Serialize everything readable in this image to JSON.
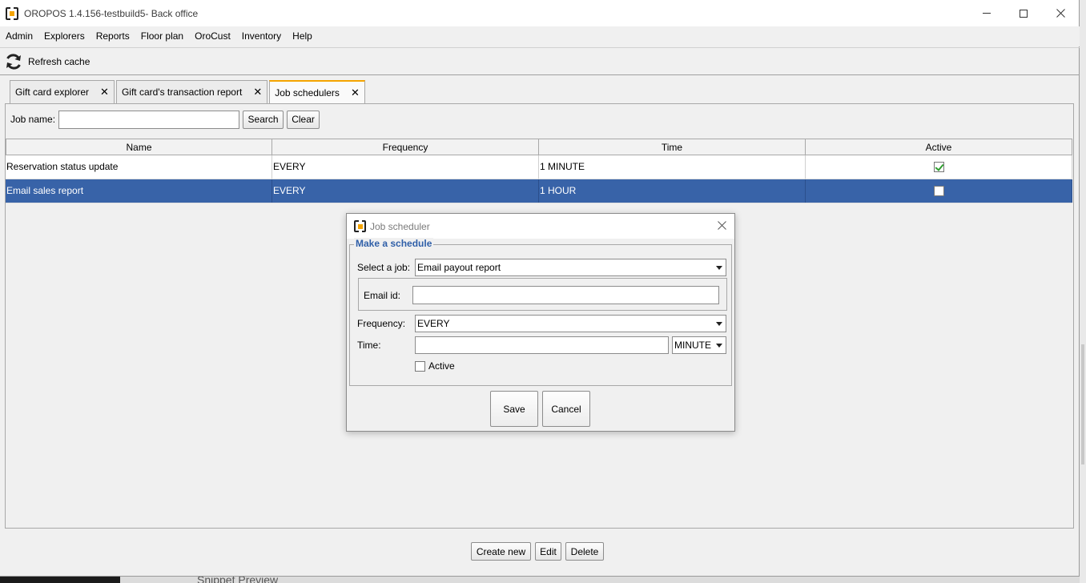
{
  "window": {
    "title": "OROPOS 1.4.156-testbuild5- Back office",
    "controls": [
      "minimize-icon",
      "maximize-icon",
      "close-icon"
    ]
  },
  "menu": {
    "items": [
      "Admin",
      "Explorers",
      "Reports",
      "Floor plan",
      "OroCust",
      "Inventory",
      "Help"
    ]
  },
  "toolbar": {
    "refresh_label": "Refresh cache",
    "refresh_icon": "refresh-icon"
  },
  "tabs": [
    {
      "label": "Gift card explorer",
      "active": false
    },
    {
      "label": "Gift card's transaction report",
      "active": false
    },
    {
      "label": "Job schedulers",
      "active": true
    }
  ],
  "search": {
    "label": "Job name:",
    "value": "",
    "search_label": "Search",
    "clear_label": "Clear"
  },
  "table": {
    "columns": [
      "Name",
      "Frequency",
      "Time",
      "Active"
    ],
    "rows": [
      {
        "name": "Reservation status update",
        "frequency": "EVERY",
        "time": "1 MINUTE",
        "active": true,
        "selected": false
      },
      {
        "name": "Email sales report",
        "frequency": "EVERY",
        "time": "1 HOUR",
        "active": false,
        "selected": true
      }
    ]
  },
  "actions": {
    "create_label": "Create new",
    "edit_label": "Edit",
    "delete_label": "Delete"
  },
  "dialog": {
    "title": "Job scheduler",
    "section": "Make a schedule",
    "job_label": "Select a job:",
    "job_value": "Email payout report",
    "email_label": "Email id:",
    "email_value": "",
    "frequency_label": "Frequency:",
    "frequency_value": "EVERY",
    "time_label": "Time:",
    "time_value": "",
    "time_unit": "MINUTE",
    "active_label": "Active",
    "active_checked": false,
    "save_label": "Save",
    "cancel_label": "Cancel"
  },
  "background": {
    "ghost_text": "Snippet Preview"
  },
  "colors": {
    "selection": "#3863a8",
    "accent": "#f5a400",
    "section_title": "#2f5fa8"
  }
}
